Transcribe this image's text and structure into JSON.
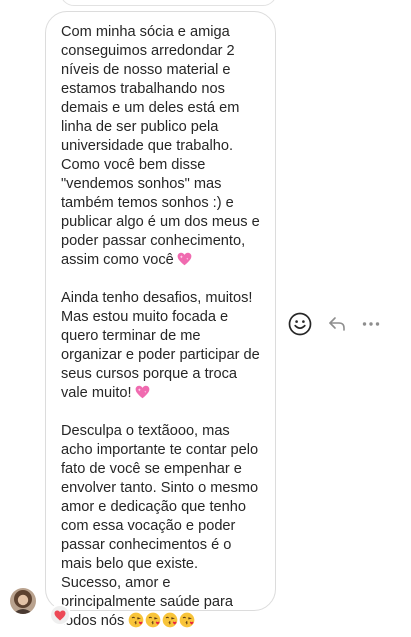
{
  "message": {
    "paragraph1": "Com minha sócia e amiga\nconseguimos arredondar 2\nníveis de nosso material e\nestamos trabalhando nos\ndemais e um deles está em\nlinha de ser publico pela\nuniversidade que trabalho.\nComo você bem disse\n\"vendemos sonhos\" mas\ntambém temos sonhos :) e\npublicar algo é um dos meus e\npoder passar conhecimento,\nassim como você",
    "paragraph2": "Ainda tenho desafios, muitos!\nMas estou muito focada e\nquero terminar de me\norganizar e poder participar de\nseus cursos porque a troca\nvale muito!",
    "paragraph3": "Desculpa o textãooo, mas\nacho importante te contar pelo\nfato de você se empenhar e\nenvolver tanto. Sinto o mesmo\namor e dedicação que tenho\ncom essa vocação e poder\npassar conhecimentos é o\nmais belo que existe.\nSucesso, amor e\nprincipalmente saúde para\ntodos nós",
    "paragraph1_emoji": "sparkling-heart",
    "paragraph2_emoji": "sparkling-heart",
    "paragraph3_emojis": [
      "face-blowing-kiss",
      "face-blowing-kiss",
      "face-blowing-kiss",
      "face-blowing-kiss"
    ]
  },
  "actions": {
    "react_icon": "smiley-face-icon",
    "reply_icon": "reply-arrow-icon",
    "more_icon": "more-options-icon"
  },
  "reaction": {
    "emoji": "red-heart"
  },
  "colors": {
    "text": "#262626",
    "bubble_border": "#dcdcdc",
    "icon": "#8e8e8e",
    "heart": "#ed4956",
    "sparkling_heart": "#f06bb0"
  }
}
